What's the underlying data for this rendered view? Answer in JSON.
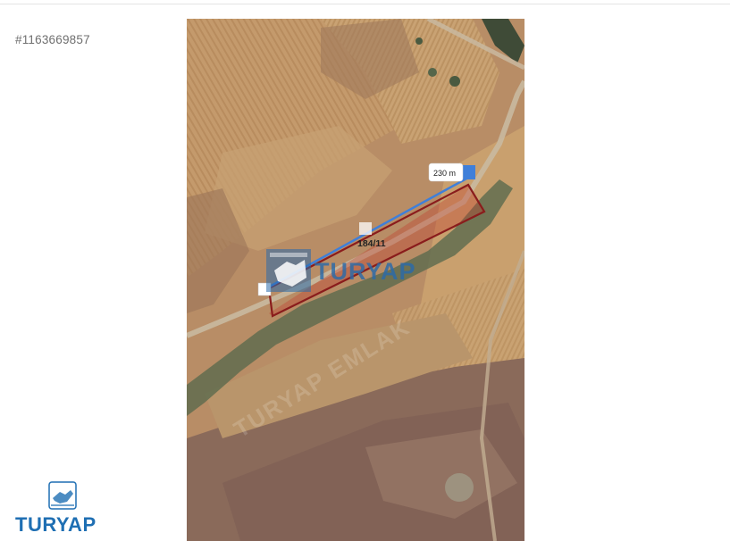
{
  "listing": {
    "id_text": "#1163669857"
  },
  "map": {
    "distance_label": "230 m",
    "parcel_label": "184/11",
    "watermark_text": "TURYAP",
    "diagonal_watermark": "TURYAP EMLAK",
    "colors": {
      "measure_line": "#3f7fd9",
      "parcel_outline": "#8a1c1c",
      "parcel_fill": "#c0392b",
      "watermark": "#2a6aaa"
    }
  },
  "footer": {
    "logo_text": "TURYAP",
    "logo_icon": "handshake-icon",
    "brand_color": "#1f6fb3"
  }
}
